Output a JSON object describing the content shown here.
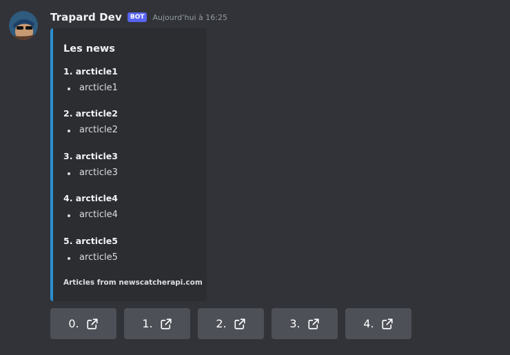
{
  "message": {
    "username": "Trapard Dev",
    "bot_tag": "BOT",
    "timestamp": "Aujourd’hui à 16:25"
  },
  "embed": {
    "accent_color": "#2b8ed1",
    "title": "Les news",
    "articles": [
      {
        "heading": "1. arcticle1",
        "text": "arcticle1"
      },
      {
        "heading": "2. arcticle2",
        "text": "arcticle2"
      },
      {
        "heading": "3. arcticle3",
        "text": "arcticle3"
      },
      {
        "heading": "4. arcticle4",
        "text": "arcticle4"
      },
      {
        "heading": "5. arcticle5",
        "text": "arcticle5"
      }
    ],
    "footer": "Articles from newscatcherapi.com"
  },
  "buttons": [
    {
      "label": "0.",
      "icon": "external-link-icon"
    },
    {
      "label": "1.",
      "icon": "external-link-icon"
    },
    {
      "label": "2.",
      "icon": "external-link-icon"
    },
    {
      "label": "3.",
      "icon": "external-link-icon"
    },
    {
      "label": "4.",
      "icon": "external-link-icon"
    }
  ]
}
